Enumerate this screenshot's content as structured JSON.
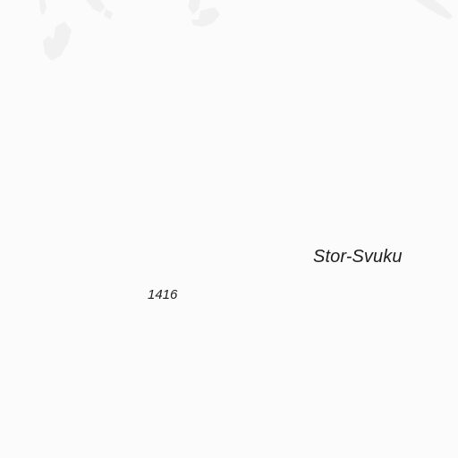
{
  "map": {
    "place_name": "Stor-Svuku",
    "elevation": "1416",
    "colors": {
      "background": "#fbfbfb",
      "terrain_shading": "#f0f1f0",
      "label_text": "#1e1e1e"
    }
  }
}
